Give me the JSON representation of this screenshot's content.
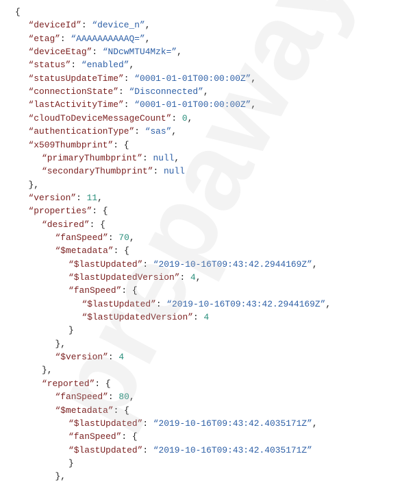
{
  "colors": {
    "key": "#7a1e1e",
    "string": "#2d5fa6",
    "number": "#2a8f7c",
    "punctuation": "#1f1f1f"
  },
  "watermark": "prepaway",
  "lines": [
    {
      "indent": 0,
      "tokens": [
        {
          "t": "{",
          "c": "p"
        }
      ]
    },
    {
      "indent": 1,
      "tokens": [
        {
          "t": "“deviceId”",
          "c": "k"
        },
        {
          "t": ": ",
          "c": "p"
        },
        {
          "t": "“device_n”",
          "c": "s"
        },
        {
          "t": ",",
          "c": "p"
        }
      ]
    },
    {
      "indent": 1,
      "tokens": [
        {
          "t": "“etag”",
          "c": "k"
        },
        {
          "t": ": ",
          "c": "p"
        },
        {
          "t": "“AAAAAAAAAAQ=”",
          "c": "s"
        },
        {
          "t": ",",
          "c": "p"
        }
      ]
    },
    {
      "indent": 1,
      "tokens": [
        {
          "t": "“deviceEtag”",
          "c": "k"
        },
        {
          "t": ": ",
          "c": "p"
        },
        {
          "t": "“NDcwMTU4Mzk=”",
          "c": "s"
        },
        {
          "t": ",",
          "c": "p"
        }
      ]
    },
    {
      "indent": 1,
      "tokens": [
        {
          "t": "“status”",
          "c": "k"
        },
        {
          "t": ": ",
          "c": "p"
        },
        {
          "t": "“enabled”",
          "c": "s"
        },
        {
          "t": ",",
          "c": "p"
        }
      ]
    },
    {
      "indent": 1,
      "tokens": [
        {
          "t": "“statusUpdateTime”",
          "c": "k"
        },
        {
          "t": ": ",
          "c": "p"
        },
        {
          "t": "“0001-01-01T00:00:00Z”",
          "c": "s"
        },
        {
          "t": ",",
          "c": "p"
        }
      ]
    },
    {
      "indent": 1,
      "tokens": [
        {
          "t": "“connectionState”",
          "c": "k"
        },
        {
          "t": ": ",
          "c": "p"
        },
        {
          "t": "“Disconnected”",
          "c": "s"
        },
        {
          "t": ",",
          "c": "p"
        }
      ]
    },
    {
      "indent": 1,
      "tokens": [
        {
          "t": "“lastActivityTime”",
          "c": "k"
        },
        {
          "t": ": ",
          "c": "p"
        },
        {
          "t": "“0001-01-01T00:00:00Z”",
          "c": "s"
        },
        {
          "t": ",",
          "c": "p"
        }
      ]
    },
    {
      "indent": 1,
      "tokens": [
        {
          "t": "“cloudToDeviceMessageCount”",
          "c": "k"
        },
        {
          "t": ": ",
          "c": "p"
        },
        {
          "t": "0",
          "c": "n"
        },
        {
          "t": ",",
          "c": "p"
        }
      ]
    },
    {
      "indent": 1,
      "tokens": [
        {
          "t": "“authenticationType”",
          "c": "k"
        },
        {
          "t": ": ",
          "c": "p"
        },
        {
          "t": "“sas”",
          "c": "s"
        },
        {
          "t": ",",
          "c": "p"
        }
      ]
    },
    {
      "indent": 1,
      "tokens": [
        {
          "t": "“x509Thumbprint”",
          "c": "k"
        },
        {
          "t": ": {",
          "c": "p"
        }
      ]
    },
    {
      "indent": 2,
      "tokens": [
        {
          "t": "“primaryThumbprint”",
          "c": "k"
        },
        {
          "t": ": ",
          "c": "p"
        },
        {
          "t": "null",
          "c": "lit"
        },
        {
          "t": ",",
          "c": "p"
        }
      ]
    },
    {
      "indent": 2,
      "tokens": [
        {
          "t": "“secondaryThumbprint”",
          "c": "k"
        },
        {
          "t": ": ",
          "c": "p"
        },
        {
          "t": "null",
          "c": "lit"
        }
      ]
    },
    {
      "indent": 1,
      "tokens": [
        {
          "t": "},",
          "c": "p"
        }
      ]
    },
    {
      "indent": 1,
      "tokens": [
        {
          "t": "“version”",
          "c": "k"
        },
        {
          "t": ": ",
          "c": "p"
        },
        {
          "t": "11",
          "c": "n"
        },
        {
          "t": ",",
          "c": "p"
        }
      ]
    },
    {
      "indent": 1,
      "tokens": [
        {
          "t": "“properties”",
          "c": "k"
        },
        {
          "t": ": {",
          "c": "p"
        }
      ]
    },
    {
      "indent": 2,
      "tokens": [
        {
          "t": "“desired”",
          "c": "k"
        },
        {
          "t": ": {",
          "c": "p"
        }
      ]
    },
    {
      "indent": 3,
      "tokens": [
        {
          "t": "“fanSpeed”",
          "c": "k"
        },
        {
          "t": ": ",
          "c": "p"
        },
        {
          "t": "70",
          "c": "n"
        },
        {
          "t": ",",
          "c": "p"
        }
      ]
    },
    {
      "indent": 3,
      "tokens": [
        {
          "t": "“$metadata”",
          "c": "k"
        },
        {
          "t": ": {",
          "c": "p"
        }
      ]
    },
    {
      "indent": 4,
      "tokens": [
        {
          "t": "“$lastUpdated”",
          "c": "k"
        },
        {
          "t": ": ",
          "c": "p"
        },
        {
          "t": "“2019-10-16T09:43:42.2944169Z”",
          "c": "s"
        },
        {
          "t": ",",
          "c": "p"
        }
      ]
    },
    {
      "indent": 4,
      "tokens": [
        {
          "t": "“$lastUpdatedVersion”",
          "c": "k"
        },
        {
          "t": ": ",
          "c": "p"
        },
        {
          "t": "4",
          "c": "n"
        },
        {
          "t": ",",
          "c": "p"
        }
      ]
    },
    {
      "indent": 4,
      "tokens": [
        {
          "t": "“fanSpeed”",
          "c": "k"
        },
        {
          "t": ": {",
          "c": "p"
        }
      ]
    },
    {
      "indent": 5,
      "tokens": [
        {
          "t": "“$lastUpdated”",
          "c": "k"
        },
        {
          "t": ": ",
          "c": "p"
        },
        {
          "t": "“2019-10-16T09:43:42.2944169Z”",
          "c": "s"
        },
        {
          "t": ",",
          "c": "p"
        }
      ]
    },
    {
      "indent": 5,
      "tokens": [
        {
          "t": "“$lastUpdatedVersion”",
          "c": "k"
        },
        {
          "t": ": ",
          "c": "p"
        },
        {
          "t": "4",
          "c": "n"
        }
      ]
    },
    {
      "indent": 4,
      "tokens": [
        {
          "t": "}",
          "c": "p"
        }
      ]
    },
    {
      "indent": 3,
      "tokens": [
        {
          "t": "},",
          "c": "p"
        }
      ]
    },
    {
      "indent": 3,
      "tokens": [
        {
          "t": "“$version”",
          "c": "k"
        },
        {
          "t": ": ",
          "c": "p"
        },
        {
          "t": "4",
          "c": "n"
        }
      ]
    },
    {
      "indent": 2,
      "tokens": [
        {
          "t": "},",
          "c": "p"
        }
      ]
    },
    {
      "indent": 2,
      "tokens": [
        {
          "t": "“reported”",
          "c": "k"
        },
        {
          "t": ": {",
          "c": "p"
        }
      ]
    },
    {
      "indent": 3,
      "tokens": [
        {
          "t": "“fanSpeed”",
          "c": "k"
        },
        {
          "t": ": ",
          "c": "p"
        },
        {
          "t": "80",
          "c": "n"
        },
        {
          "t": ",",
          "c": "p"
        }
      ]
    },
    {
      "indent": 3,
      "tokens": [
        {
          "t": "“$metadata”",
          "c": "k"
        },
        {
          "t": ": {",
          "c": "p"
        }
      ]
    },
    {
      "indent": 4,
      "tokens": [
        {
          "t": "“$lastUpdated”",
          "c": "k"
        },
        {
          "t": ": ",
          "c": "p"
        },
        {
          "t": "“2019-10-16T09:43:42.4035171Z”",
          "c": "s"
        },
        {
          "t": ",",
          "c": "p"
        }
      ]
    },
    {
      "indent": 4,
      "tokens": [
        {
          "t": "“fanSpeed”",
          "c": "k"
        },
        {
          "t": ": {",
          "c": "p"
        }
      ]
    },
    {
      "indent": 4,
      "tokens": [
        {
          "t": "“$lastUpdated”",
          "c": "k"
        },
        {
          "t": ": ",
          "c": "p"
        },
        {
          "t": "“2019-10-16T09:43:42.4035171Z”",
          "c": "s"
        }
      ]
    },
    {
      "indent": 4,
      "tokens": [
        {
          "t": "}",
          "c": "p"
        }
      ]
    },
    {
      "indent": 3,
      "tokens": [
        {
          "t": "},",
          "c": "p"
        }
      ]
    }
  ]
}
